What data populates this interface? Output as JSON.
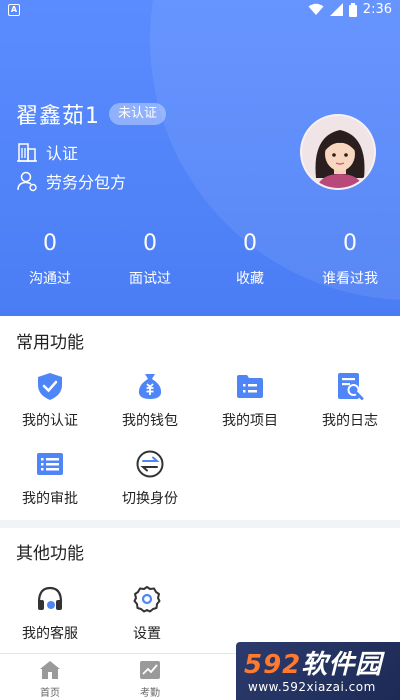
{
  "status_bar": {
    "time": "2:36",
    "left_icon": "A"
  },
  "profile": {
    "name": "翟鑫茹1",
    "badge": "未认证",
    "info": [
      {
        "icon": "building-icon",
        "label": "认证"
      },
      {
        "icon": "user-settings-icon",
        "label": "劳务分包方"
      }
    ]
  },
  "stats": [
    {
      "value": "0",
      "label": "沟通过"
    },
    {
      "value": "0",
      "label": "面试过"
    },
    {
      "value": "0",
      "label": "收藏"
    },
    {
      "value": "0",
      "label": "谁看过我"
    }
  ],
  "common_functions": {
    "title": "常用功能",
    "items": [
      {
        "icon": "shield-check-icon",
        "label": "我的认证"
      },
      {
        "icon": "money-bag-icon",
        "label": "我的钱包"
      },
      {
        "icon": "folder-list-icon",
        "label": "我的项目"
      },
      {
        "icon": "log-search-icon",
        "label": "我的日志"
      },
      {
        "icon": "approval-list-icon",
        "label": "我的审批"
      },
      {
        "icon": "switch-identity-icon",
        "label": "切换身份"
      }
    ]
  },
  "other_functions": {
    "title": "其他功能",
    "items": [
      {
        "icon": "headset-icon",
        "label": "我的客服"
      },
      {
        "icon": "settings-gear-icon",
        "label": "设置"
      }
    ]
  },
  "tabbar": [
    {
      "icon": "home-icon",
      "label": "首页"
    },
    {
      "icon": "attendance-chart-icon",
      "label": "考勤"
    }
  ],
  "watermark": {
    "brand_num": "592",
    "brand_text": "软件园",
    "url": "www.592xiazai.com"
  },
  "colors": {
    "header": "#4a7df4",
    "accent": "#4f86f7",
    "icon_light": "#e6eeff"
  }
}
